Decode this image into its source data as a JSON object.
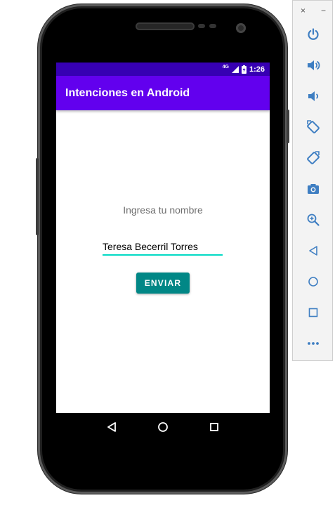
{
  "status_bar": {
    "network": "4G",
    "time": "1:26"
  },
  "app_bar": {
    "title": "Intenciones en Android"
  },
  "form": {
    "label": "Ingresa tu nombre",
    "name_value": "Teresa Becerril Torres",
    "send_label": "ENVIAR"
  },
  "navigation": {
    "icons": [
      "back-icon",
      "home-icon",
      "recents-icon"
    ]
  },
  "emulator_panel": {
    "close_label": "×",
    "minimize_label": "−",
    "tools": [
      "power",
      "volume-up",
      "volume-down",
      "rotate-left",
      "rotate-right",
      "screenshot",
      "zoom",
      "back",
      "home",
      "overview",
      "more"
    ]
  },
  "colors": {
    "status_bar": "#3700b3",
    "app_bar": "#6200ee",
    "button": "#018786",
    "input_underline": "#03dac5",
    "panel_icon": "#3e7ec2"
  }
}
